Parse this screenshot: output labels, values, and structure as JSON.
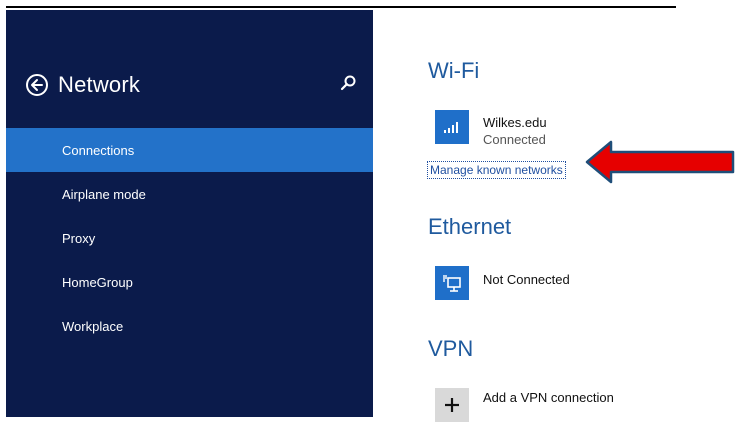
{
  "sidebar": {
    "title": "Network",
    "items": [
      {
        "label": "Connections",
        "active": true
      },
      {
        "label": "Airplane mode"
      },
      {
        "label": "Proxy"
      },
      {
        "label": "HomeGroup"
      },
      {
        "label": "Workplace"
      }
    ],
    "accent_color": "#2372c9",
    "background_color": "#0b1b4b"
  },
  "wifi": {
    "heading": "Wi-Fi",
    "network_name": "Wilkes.edu",
    "status": "Connected",
    "manage_link": "Manage known networks"
  },
  "ethernet": {
    "heading": "Ethernet",
    "status": "Not Connected"
  },
  "vpn": {
    "heading": "VPN",
    "add_label": "Add a VPN connection"
  },
  "icons": {
    "back": "back-arrow-icon",
    "search": "search-icon",
    "wifi": "wifi-signal-icon",
    "ethernet": "ethernet-icon",
    "add": "plus-icon",
    "annotation": "red-arrow-annotation"
  },
  "colors": {
    "heading": "#1f5a9e",
    "tile": "#1f6fc9",
    "annotation_fill": "#e60000",
    "annotation_outline": "#1f4e79"
  }
}
